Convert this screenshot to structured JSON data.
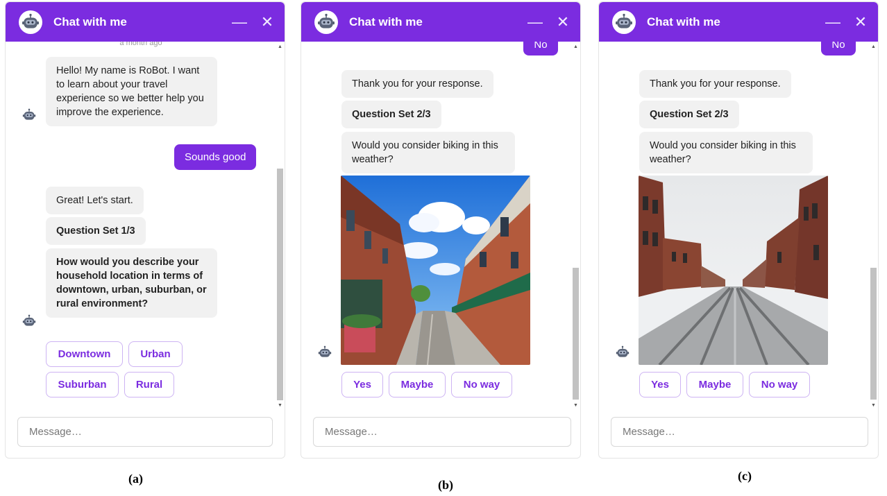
{
  "colors": {
    "accent": "#7b2ce0",
    "bot_bubble": "#f1f1f1",
    "chip_border": "#cdb3f3"
  },
  "header": {
    "title": "Chat with me",
    "minimize": "—",
    "close": "✕"
  },
  "input_placeholder": "Message…",
  "panels": [
    {
      "caption": "(a)",
      "timestamp": "a month ago",
      "greeting": "Hello! My name is RoBot. I want to learn about your travel experience so we better help you improve the experience.",
      "user_reply": "Sounds good",
      "start": "Great! Let's start.",
      "question_set": "Question Set 1/3",
      "question": "How would you describe your household location in terms of downtown, urban, suburban, or rural environment?",
      "options": [
        "Downtown",
        "Urban",
        "Suburban",
        "Rural"
      ],
      "scroll_fraction": 0.62
    },
    {
      "caption": "(b)",
      "prev_user_reply": "No",
      "thanks": "Thank you for your response.",
      "question_set": "Question Set 2/3",
      "question": "Would you consider biking in this weather?",
      "image": "sunny-street-photo",
      "options": [
        "Yes",
        "Maybe",
        "No way"
      ],
      "scroll_fraction": 0.98
    },
    {
      "caption": "(c)",
      "prev_user_reply": "No",
      "thanks": "Thank you for your response.",
      "question_set": "Question Set 2/3",
      "question": "Would you consider biking in this weather?",
      "image": "snowy-street-photo",
      "options": [
        "Yes",
        "Maybe",
        "No way"
      ],
      "scroll_fraction": 0.98
    }
  ]
}
